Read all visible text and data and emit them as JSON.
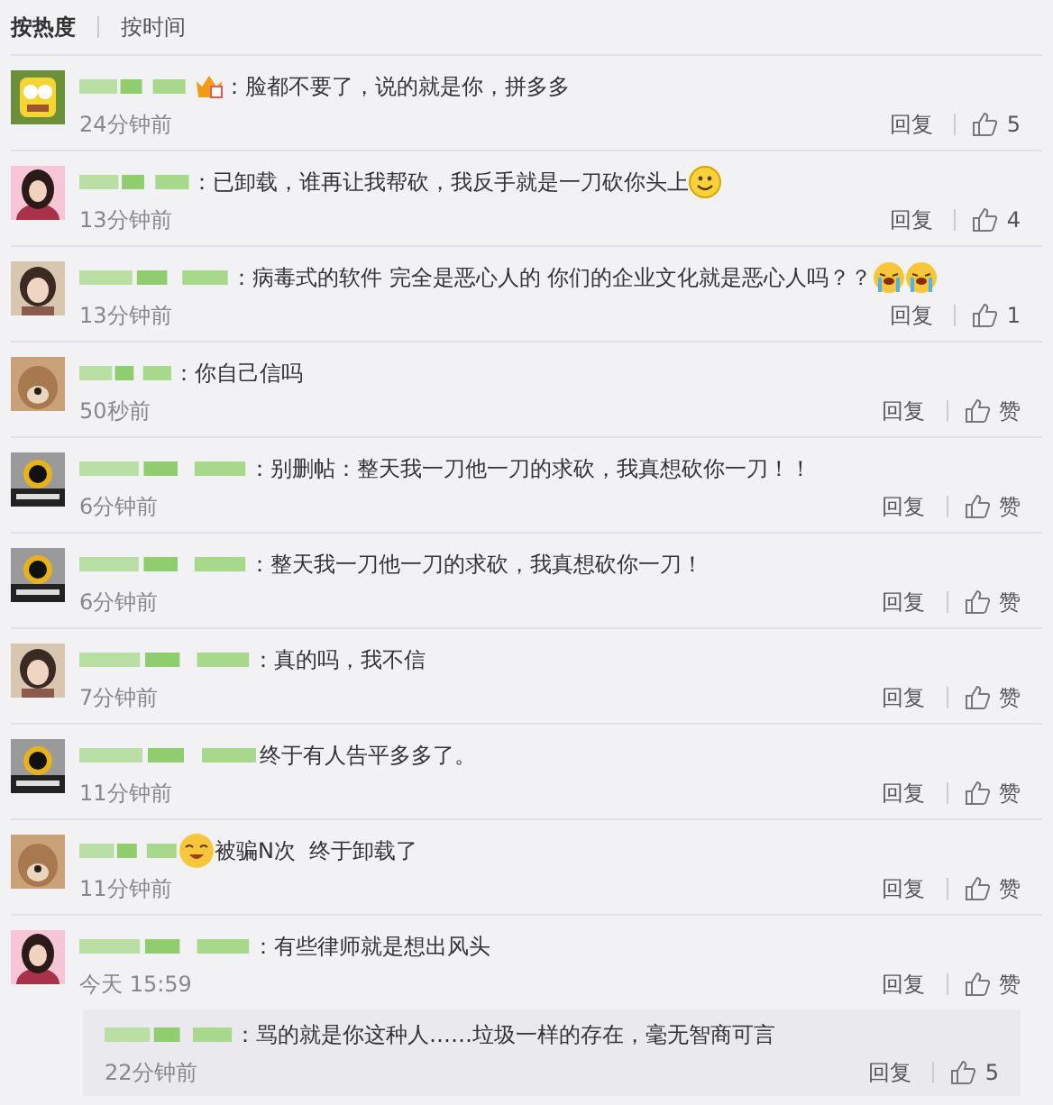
{
  "sort_tabs": [
    {
      "label": "按热度",
      "selected": true
    },
    {
      "label": "按时间",
      "selected": false
    }
  ],
  "comments": [
    {
      "badge": true,
      "text": "：脸都不要了，说的就是你，拼多多",
      "time": "24分钟前",
      "reply": "回复",
      "likes": "5"
    },
    {
      "text": "：已卸载，谁再让我帮砍，我反手就是一刀砍你头上",
      "emojis": [
        {
          "kind": "smile"
        }
      ],
      "time": "13分钟前",
      "reply": "回复",
      "likes": "4"
    },
    {
      "text": "：病毒式的软件 完全是恶心人的 你们的企业文化就是恶心人吗？？",
      "emojis": [
        {
          "kind": "cry"
        },
        {
          "kind": "cry"
        }
      ],
      "time": "13分钟前",
      "reply": "回复",
      "likes": "1"
    },
    {
      "text": "：你自己信吗",
      "time": "50秒前",
      "reply": "回复",
      "likes": "赞"
    },
    {
      "text": "：别删帖：整天我一刀他一刀的求砍，我真想砍你一刀！！",
      "time": "6分钟前",
      "reply": "回复",
      "likes": "赞"
    },
    {
      "text": "：整天我一刀他一刀的求砍，我真想砍你一刀！",
      "time": "6分钟前",
      "reply": "回复",
      "likes": "赞"
    },
    {
      "text": "：真的吗，我不信",
      "time": "7分钟前",
      "reply": "回复",
      "likes": "赞"
    },
    {
      "text": "终于有人告平多多了。",
      "time": "11分钟前",
      "reply": "回复",
      "likes": "赞"
    },
    {
      "text": "被骗N次  终于卸载了",
      "lead_emoji": {
        "kind": "grin"
      },
      "time": "11分钟前",
      "reply": "回复",
      "likes": "赞"
    },
    {
      "text": "：有些律师就是想出风头",
      "time": "今天 15:59",
      "reply": "回复",
      "likes": "赞",
      "replies": [
        {
          "text": "：骂的就是你这种人……垃圾一样的存在，毫无智商可言",
          "time": "22分钟前",
          "reply": "回复",
          "likes": "5"
        }
      ]
    }
  ]
}
